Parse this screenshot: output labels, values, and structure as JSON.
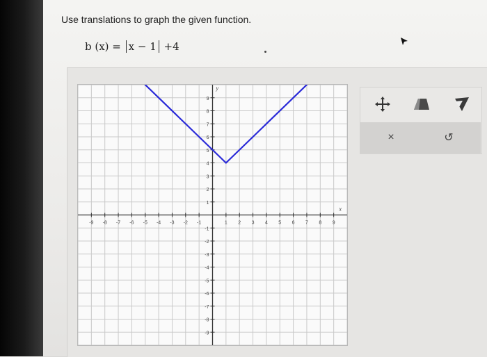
{
  "question": {
    "text": "Use translations to graph the given function."
  },
  "formula": {
    "lhs": "b (x) =",
    "abs_inner": "x − 1",
    "rhs": "+4"
  },
  "graph": {
    "x_ticks": [
      "-9",
      "-8",
      "-7",
      "-6",
      "-5",
      "-4",
      "-3",
      "-2",
      "-1",
      "1",
      "2",
      "3",
      "4",
      "5",
      "6",
      "7",
      "8",
      "9"
    ],
    "y_ticks": [
      "9",
      "8",
      "7",
      "6",
      "5",
      "4",
      "3",
      "2",
      "1",
      "-1",
      "-2",
      "-3",
      "-4",
      "-5",
      "-6",
      "-7",
      "-8",
      "-9"
    ],
    "x_label": "x",
    "y_label": "y",
    "line_color": "#2a2ad8"
  },
  "chart_data": {
    "type": "line",
    "xlim": [
      -10,
      10
    ],
    "ylim": [
      -10,
      10
    ],
    "series": [
      {
        "x": [
          -10,
          1,
          10
        ],
        "y": [
          15,
          4,
          13
        ]
      }
    ],
    "grid": true
  },
  "tools": {
    "move_icon": "move-arrows-icon",
    "polygon_icon": "shape-icon",
    "function_icon": "graph-type-icon",
    "clear_label": "×",
    "undo_label": "↺"
  }
}
